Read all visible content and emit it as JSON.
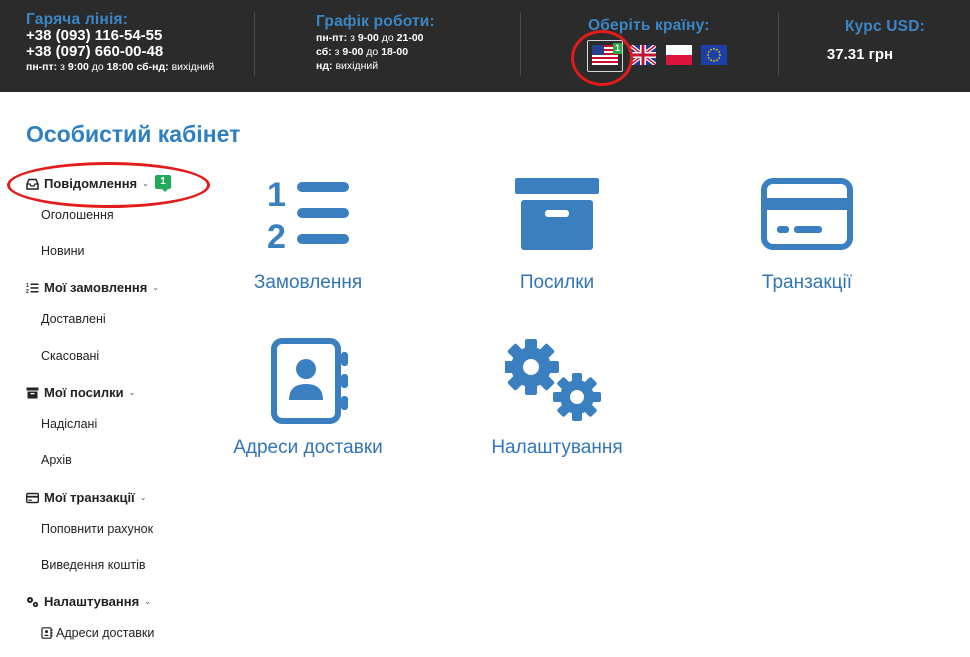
{
  "topbar": {
    "hotline_title": "Гаряча лінія:",
    "phone1": "+38 (093) 116-54-55",
    "phone2": "+38 (097) 660-00-48",
    "hotline_hours": {
      "d1": "пн-пт:",
      "w1": "з",
      "t1": "9:00",
      "w2": "до",
      "t2": "18:00",
      "d2": "сб-нд:",
      "off": "вихідний"
    },
    "schedule_title": "Графік роботи:",
    "schedule": [
      {
        "day": "пн-пт:",
        "from_w": "з",
        "from": "9-00",
        "to_w": "до",
        "to": "21-00"
      },
      {
        "day": "сб:",
        "from_w": "з",
        "from": "9-00",
        "to_w": "до",
        "to": "18-00"
      },
      {
        "day": "нд:",
        "off": "вихідний"
      }
    ],
    "country_title": "Оберіть країну:",
    "country_badge": "1",
    "flags": [
      "us-flag",
      "uk-flag",
      "pl-flag",
      "eu-flag"
    ],
    "usd_title": "Курс USD:",
    "usd_value": "37.31 грн"
  },
  "page_title": "Особистий кабінет",
  "sidebar": {
    "messages": {
      "label": "Повідомлення",
      "badge": "1",
      "items": [
        "Оголошення",
        "Новини"
      ]
    },
    "orders": {
      "label": "Мої замовлення",
      "items": [
        "Доставлені",
        "Скасовані"
      ]
    },
    "parcels": {
      "label": "Мої посилки",
      "items": [
        "Надіслані",
        "Архів"
      ]
    },
    "transactions": {
      "label": "Мої транзакції",
      "items": [
        "Поповнити рахунок",
        "Виведення коштів"
      ]
    },
    "settings": {
      "label": "Налаштування",
      "items": [
        "Адреси доставки"
      ]
    }
  },
  "tiles": {
    "orders": "Замовлення",
    "parcels": "Посилки",
    "transactions": "Транзакції",
    "addresses": "Адреси доставки",
    "settings": "Налаштування"
  },
  "colors": {
    "topbar_bg": "#2b2b2b",
    "accent": "#2f7fc1",
    "tile_icon": "#3a7fc0",
    "badge_green": "#1fab5a",
    "highlight_red": "#e21b1b"
  }
}
